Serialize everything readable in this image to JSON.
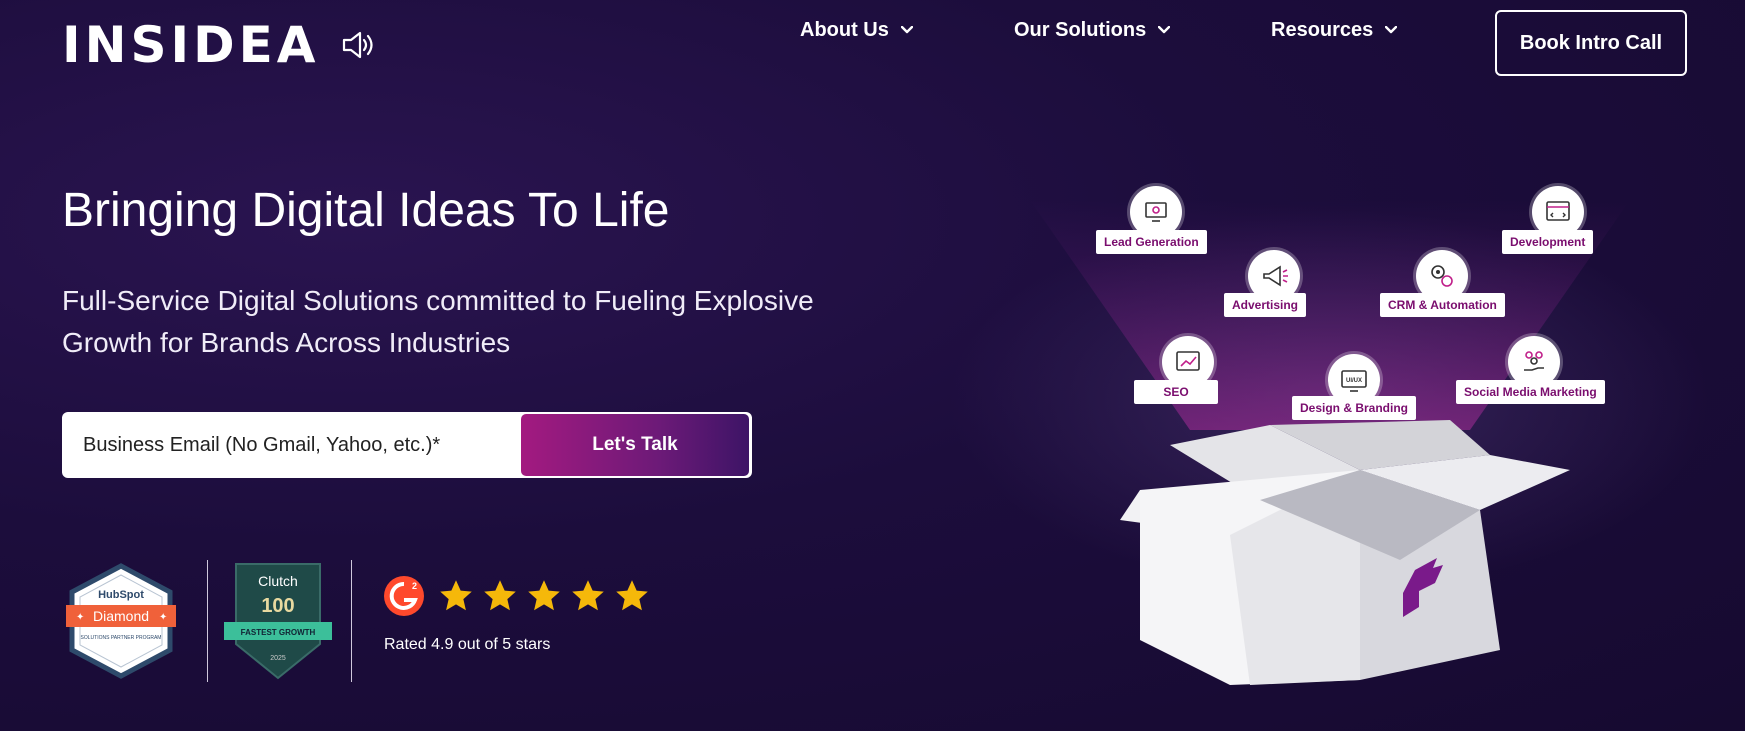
{
  "header": {
    "logo_text": "INSIDEA",
    "nav": [
      {
        "label": "About Us"
      },
      {
        "label": "Our Solutions"
      },
      {
        "label": "Resources"
      }
    ],
    "cta_label": "Book Intro Call"
  },
  "hero": {
    "title": "Bringing Digital Ideas To Life",
    "subtitle": "Full-Service Digital Solutions committed to Fueling Explosive Growth for Brands Across Industries",
    "email_placeholder": "Business Email (No Gmail, Yahoo, etc.)*",
    "submit_label": "Let's Talk"
  },
  "badges": {
    "hubspot": {
      "brand": "HubSpot",
      "tier": "Diamond",
      "program": "SOLUTIONS PARTNER PROGRAM"
    },
    "clutch": {
      "brand": "Clutch",
      "rank": "100",
      "ribbon": "FASTEST GROWTH",
      "year": "2025"
    },
    "g2": {
      "logo": "G2",
      "stars": 5,
      "rating_text": "Rated 4.9 out of 5 stars"
    }
  },
  "services": [
    {
      "label": "Lead Generation",
      "icon": "monitor-gear-icon"
    },
    {
      "label": "Development",
      "icon": "browser-code-icon"
    },
    {
      "label": "Advertising",
      "icon": "megaphone-icon"
    },
    {
      "label": "CRM & Automation",
      "icon": "gears-icon"
    },
    {
      "label": "SEO",
      "icon": "seo-chart-icon"
    },
    {
      "label": "Design & Branding",
      "icon": "uiux-monitor-icon",
      "icon_text": "UI/UX"
    },
    {
      "label": "Social Media Marketing",
      "icon": "social-hand-icon"
    }
  ],
  "colors": {
    "background": "#1c0d3c",
    "accent_magenta": "#a31a80",
    "label_text": "#7a0d6e",
    "star": "#f5b80a",
    "hubspot_orange": "#f0613a",
    "clutch_green": "#3cbf9a"
  }
}
